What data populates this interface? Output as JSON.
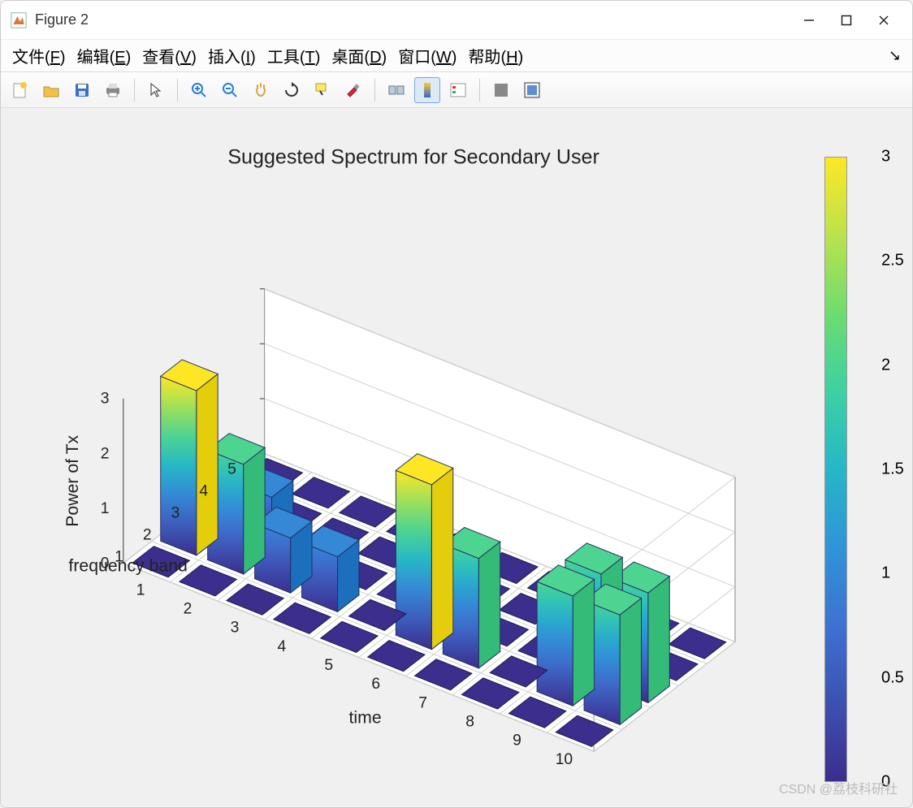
{
  "window": {
    "title": "Figure 2"
  },
  "menu": {
    "file": {
      "label": "文件",
      "hotkey": "F"
    },
    "edit": {
      "label": "编辑",
      "hotkey": "E"
    },
    "view": {
      "label": "查看",
      "hotkey": "V"
    },
    "insert": {
      "label": "插入",
      "hotkey": "I"
    },
    "tools": {
      "label": "工具",
      "hotkey": "T"
    },
    "desktop": {
      "label": "桌面",
      "hotkey": "D"
    },
    "window": {
      "label": "窗口",
      "hotkey": "W"
    },
    "help": {
      "label": "帮助",
      "hotkey": "H"
    }
  },
  "chart_data": {
    "type": "bar3d",
    "title": "Suggested Spectrum for Secondary User",
    "xlabel": "time",
    "ylabel": "frequency band",
    "zlabel": "Power of Tx",
    "x_categories": [
      1,
      2,
      3,
      4,
      5,
      6,
      7,
      8,
      9,
      10
    ],
    "y_categories": [
      1,
      2,
      3,
      4,
      5
    ],
    "z_ticks": [
      0,
      1,
      2,
      3
    ],
    "colorbar_ticks": [
      0,
      0.5,
      1,
      1.5,
      2,
      2.5,
      3
    ],
    "colorbar_range": [
      0,
      3
    ],
    "grid": [
      [
        0,
        0,
        0,
        0,
        0,
        0,
        0,
        0,
        0,
        0
      ],
      [
        3,
        2,
        1,
        1,
        0,
        3,
        2,
        0,
        2,
        2
      ],
      [
        0,
        1,
        0,
        0,
        0,
        0,
        0,
        0,
        2,
        2
      ],
      [
        0,
        0,
        0,
        0,
        0,
        0,
        0,
        0,
        0,
        0
      ],
      [
        0,
        0,
        0,
        0,
        0,
        0,
        0,
        0,
        0,
        0
      ]
    ]
  },
  "watermark": "CSDN @荔枝科研社"
}
